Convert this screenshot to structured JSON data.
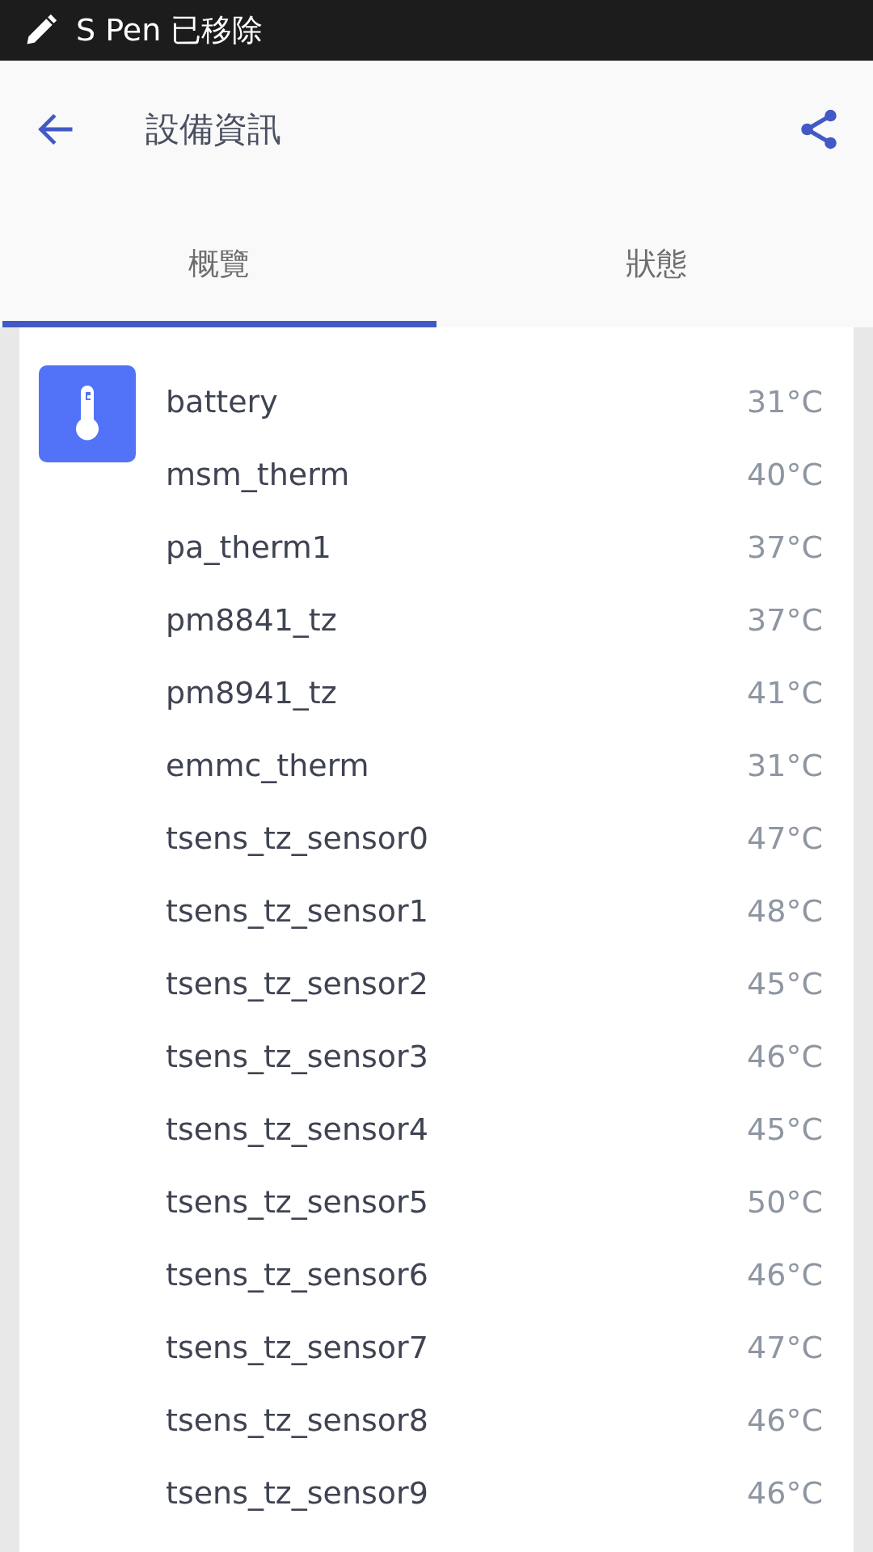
{
  "status_bar": {
    "notification": "S Pen 已移除"
  },
  "toolbar": {
    "title": "設備資訊"
  },
  "tabs": [
    {
      "label": "概覽",
      "selected": true
    },
    {
      "label": "狀態",
      "selected": false
    }
  ],
  "sensors": [
    {
      "name": "battery",
      "value": "31°C"
    },
    {
      "name": "msm_therm",
      "value": "40°C"
    },
    {
      "name": "pa_therm1",
      "value": "37°C"
    },
    {
      "name": "pm8841_tz",
      "value": "37°C"
    },
    {
      "name": "pm8941_tz",
      "value": "41°C"
    },
    {
      "name": "emmc_therm",
      "value": "31°C"
    },
    {
      "name": "tsens_tz_sensor0",
      "value": "47°C"
    },
    {
      "name": "tsens_tz_sensor1",
      "value": "48°C"
    },
    {
      "name": "tsens_tz_sensor2",
      "value": "45°C"
    },
    {
      "name": "tsens_tz_sensor3",
      "value": "46°C"
    },
    {
      "name": "tsens_tz_sensor4",
      "value": "45°C"
    },
    {
      "name": "tsens_tz_sensor5",
      "value": "50°C"
    },
    {
      "name": "tsens_tz_sensor6",
      "value": "46°C"
    },
    {
      "name": "tsens_tz_sensor7",
      "value": "47°C"
    },
    {
      "name": "tsens_tz_sensor8",
      "value": "46°C"
    },
    {
      "name": "tsens_tz_sensor9",
      "value": "46°C"
    }
  ]
}
